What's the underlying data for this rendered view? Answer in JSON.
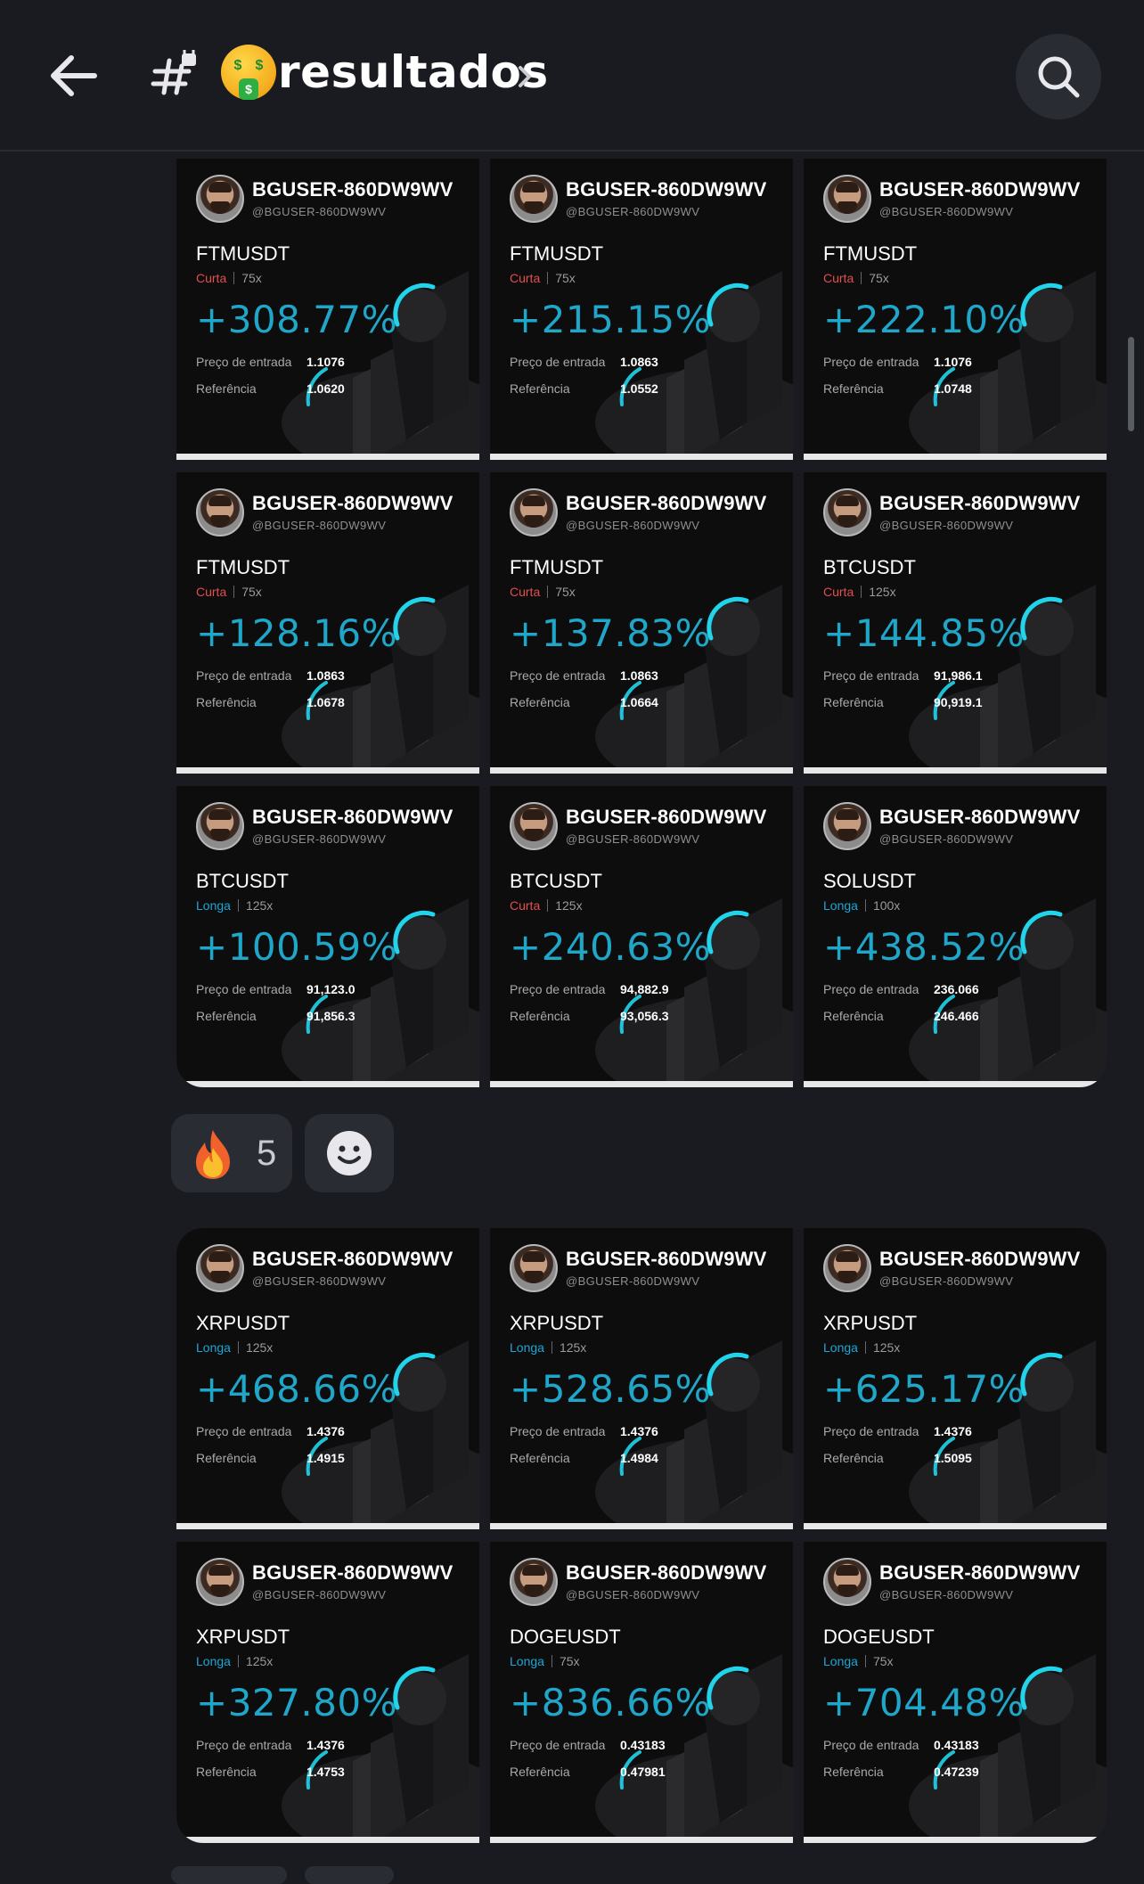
{
  "header": {
    "title": "resultados",
    "back_icon": "arrow-left-icon",
    "channel_icon": "hash-lock-icon",
    "emoji": "money-mouth-face",
    "search_icon": "search-icon"
  },
  "cards_top": [
    {
      "user": "BGUSER-860DW9WV",
      "handle": "@BGUSER-860DW9WV",
      "pair": "FTMUSDT",
      "side": "Curta",
      "leverage": "75x",
      "pnl": "+308.77%",
      "entry_label": "Preço de entrada",
      "entry": "1.1076",
      "ref_label": "Referência",
      "ref": "1.0620"
    },
    {
      "user": "BGUSER-860DW9WV",
      "handle": "@BGUSER-860DW9WV",
      "pair": "FTMUSDT",
      "side": "Curta",
      "leverage": "75x",
      "pnl": "+215.15%",
      "entry_label": "Preço de entrada",
      "entry": "1.0863",
      "ref_label": "Referência",
      "ref": "1.0552"
    },
    {
      "user": "BGUSER-860DW9WV",
      "handle": "@BGUSER-860DW9WV",
      "pair": "FTMUSDT",
      "side": "Curta",
      "leverage": "75x",
      "pnl": "+222.10%",
      "entry_label": "Preço de entrada",
      "entry": "1.1076",
      "ref_label": "Referência",
      "ref": "1.0748"
    },
    {
      "user": "BGUSER-860DW9WV",
      "handle": "@BGUSER-860DW9WV",
      "pair": "FTMUSDT",
      "side": "Curta",
      "leverage": "75x",
      "pnl": "+128.16%",
      "entry_label": "Preço de entrada",
      "entry": "1.0863",
      "ref_label": "Referência",
      "ref": "1.0678"
    },
    {
      "user": "BGUSER-860DW9WV",
      "handle": "@BGUSER-860DW9WV",
      "pair": "FTMUSDT",
      "side": "Curta",
      "leverage": "75x",
      "pnl": "+137.83%",
      "entry_label": "Preço de entrada",
      "entry": "1.0863",
      "ref_label": "Referência",
      "ref": "1.0664"
    },
    {
      "user": "BGUSER-860DW9WV",
      "handle": "@BGUSER-860DW9WV",
      "pair": "BTCUSDT",
      "side": "Curta",
      "leverage": "125x",
      "pnl": "+144.85%",
      "entry_label": "Preço de entrada",
      "entry": "91,986.1",
      "ref_label": "Referência",
      "ref": "90,919.1"
    },
    {
      "user": "BGUSER-860DW9WV",
      "handle": "@BGUSER-860DW9WV",
      "pair": "BTCUSDT",
      "side": "Longa",
      "leverage": "125x",
      "pnl": "+100.59%",
      "entry_label": "Preço de entrada",
      "entry": "91,123.0",
      "ref_label": "Referência",
      "ref": "91,856.3"
    },
    {
      "user": "BGUSER-860DW9WV",
      "handle": "@BGUSER-860DW9WV",
      "pair": "BTCUSDT",
      "side": "Curta",
      "leverage": "125x",
      "pnl": "+240.63%",
      "entry_label": "Preço de entrada",
      "entry": "94,882.9",
      "ref_label": "Referência",
      "ref": "93,056.3"
    },
    {
      "user": "BGUSER-860DW9WV",
      "handle": "@BGUSER-860DW9WV",
      "pair": "SOLUSDT",
      "side": "Longa",
      "leverage": "100x",
      "pnl": "+438.52%",
      "entry_label": "Preço de entrada",
      "entry": "236.066",
      "ref_label": "Referência",
      "ref": "246.466"
    }
  ],
  "reactions": {
    "fire_icon": "fire-icon",
    "fire_count": "5",
    "add_icon": "add-reaction-smile-icon"
  },
  "cards_bottom": [
    {
      "user": "BGUSER-860DW9WV",
      "handle": "@BGUSER-860DW9WV",
      "pair": "XRPUSDT",
      "side": "Longa",
      "leverage": "125x",
      "pnl": "+468.66%",
      "entry_label": "Preço de entrada",
      "entry": "1.4376",
      "ref_label": "Referência",
      "ref": "1.4915"
    },
    {
      "user": "BGUSER-860DW9WV",
      "handle": "@BGUSER-860DW9WV",
      "pair": "XRPUSDT",
      "side": "Longa",
      "leverage": "125x",
      "pnl": "+528.65%",
      "entry_label": "Preço de entrada",
      "entry": "1.4376",
      "ref_label": "Referência",
      "ref": "1.4984"
    },
    {
      "user": "BGUSER-860DW9WV",
      "handle": "@BGUSER-860DW9WV",
      "pair": "XRPUSDT",
      "side": "Longa",
      "leverage": "125x",
      "pnl": "+625.17%",
      "entry_label": "Preço de entrada",
      "entry": "1.4376",
      "ref_label": "Referência",
      "ref": "1.5095"
    },
    {
      "user": "BGUSER-860DW9WV",
      "handle": "@BGUSER-860DW9WV",
      "pair": "XRPUSDT",
      "side": "Longa",
      "leverage": "125x",
      "pnl": "+327.80%",
      "entry_label": "Preço de entrada",
      "entry": "1.4376",
      "ref_label": "Referência",
      "ref": "1.4753"
    },
    {
      "user": "BGUSER-860DW9WV",
      "handle": "@BGUSER-860DW9WV",
      "pair": "DOGEUSDT",
      "side": "Longa",
      "leverage": "75x",
      "pnl": "+836.66%",
      "entry_label": "Preço de entrada",
      "entry": "0.43183",
      "ref_label": "Referência",
      "ref": "0.47981"
    },
    {
      "user": "BGUSER-860DW9WV",
      "handle": "@BGUSER-860DW9WV",
      "pair": "DOGEUSDT",
      "side": "Longa",
      "leverage": "75x",
      "pnl": "+704.48%",
      "entry_label": "Preço de entrada",
      "entry": "0.43183",
      "ref_label": "Referência",
      "ref": "0.47239"
    }
  ],
  "colors": {
    "background": "#1a1b21",
    "card": "#0d0d0e",
    "pnl": "#1fa6c8",
    "short": "#e34d4d",
    "long": "#1fa6d6",
    "accent_ring": "#21d4ea"
  }
}
